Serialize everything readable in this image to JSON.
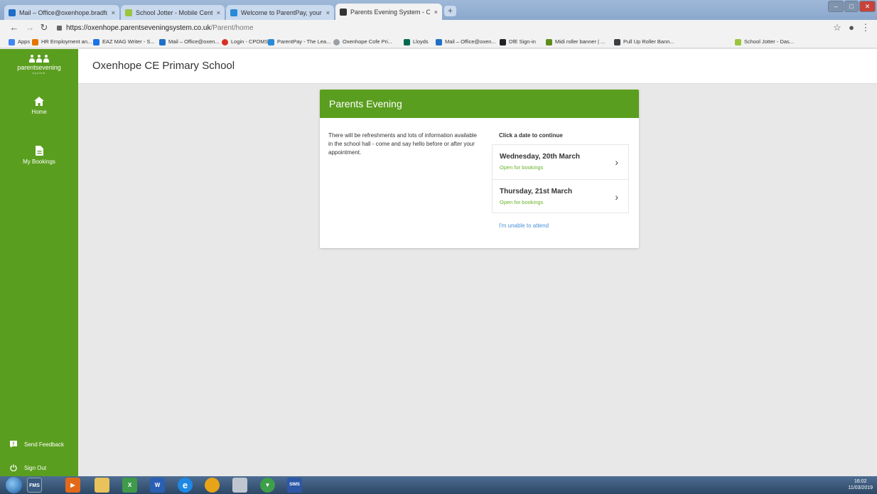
{
  "browser": {
    "tabs": [
      {
        "title": "Mail – Office@oxenhope.bradfor",
        "icon": "outlook-icon",
        "color": "#1f6fc6"
      },
      {
        "title": "School Jotter - Mobile Centre",
        "icon": "jotter-icon",
        "color": "#9bc53d"
      },
      {
        "title": "Welcome to ParentPay, your onli",
        "icon": "parentpay-icon",
        "color": "#2a8ad8"
      },
      {
        "title": "Parents Evening System - Oxenh",
        "icon": "parents-evening-icon",
        "color": "#333333",
        "active": true
      }
    ],
    "new_tab": "+",
    "close_glyph": "×",
    "url_host": "https://oxenhope.parentseveningsystem.co.uk",
    "url_path": "/Parent/home",
    "bookmarks": [
      {
        "label": "Apps",
        "color": "#4285f4"
      },
      {
        "label": "HR Employment an...",
        "color": "#e37400"
      },
      {
        "label": "EAZ MAG Writer - S...",
        "color": "#1a73e8"
      },
      {
        "label": "Mail – Office@oxen...",
        "color": "#1f6fc6"
      },
      {
        "label": "Login - CPOMS",
        "color": "#d93025"
      },
      {
        "label": "ParentPay - The Lea...",
        "color": "#2a8ad8"
      },
      {
        "label": "Oxenhope Cofe Pri...",
        "color": "#9aa0a6"
      },
      {
        "label": "Lloyds",
        "color": "#006a4d"
      },
      {
        "label": "Mail – Office@oxen...",
        "color": "#1f6fc6"
      },
      {
        "label": "DfE Sign-in",
        "color": "#202124"
      },
      {
        "label": "Midi roller banner | ...",
        "color": "#5f8d1c"
      },
      {
        "label": "Pull Up Roller Bann...",
        "color": "#3c4043"
      },
      {
        "label": "School Jotter - Das...",
        "color": "#9bc53d"
      }
    ]
  },
  "site": {
    "logo_name": "parentsevening",
    "logo_sub": "system",
    "school_name": "Oxenhope CE Primary School",
    "brand_color": "#5a9e1f"
  },
  "sidebar": {
    "nav": [
      {
        "label": "Home",
        "icon": "home-icon"
      },
      {
        "label": "My Bookings",
        "icon": "document-icon"
      }
    ],
    "footer": [
      {
        "label": "Send Feedback",
        "icon": "feedback-icon"
      },
      {
        "label": "Sign Out",
        "icon": "power-icon"
      }
    ]
  },
  "card": {
    "title": "Parents Evening",
    "description": "There will be refreshments and lots of information available in the school hall - come and say hello before or after your appointment.",
    "prompt": "Click a date to continue",
    "dates": [
      {
        "label": "Wednesday, 20th March",
        "status": "Open for bookings"
      },
      {
        "label": "Thursday, 21st March",
        "status": "Open for bookings"
      }
    ],
    "unable_link": "I'm unable to attend",
    "status_color": "#69b329",
    "link_color": "#4a8fd6"
  },
  "taskbar": {
    "apps": [
      "FMS",
      "SIMS"
    ],
    "time": "16:02",
    "date": "11/03/2019"
  }
}
